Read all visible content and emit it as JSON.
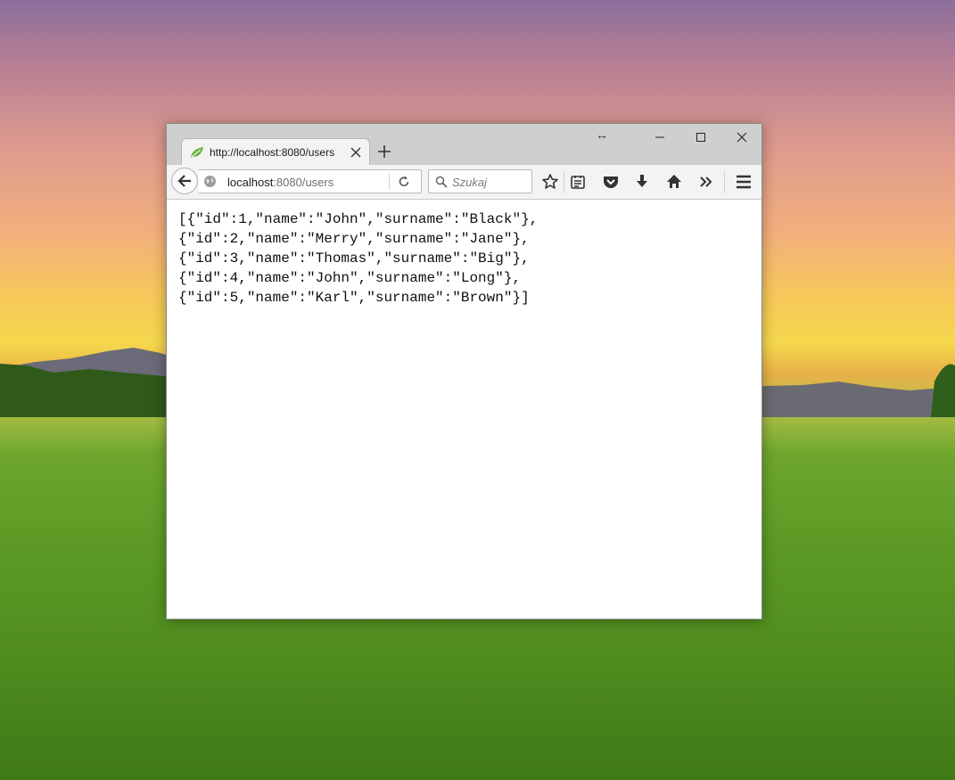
{
  "browser": {
    "tab": {
      "title": "http://localhost:8080/users"
    },
    "urlbar": {
      "host": "localhost",
      "path": ":8080/users"
    },
    "searchbar": {
      "placeholder": "Szukaj"
    }
  },
  "toolbar": {
    "icons": [
      "bookmark-star-icon",
      "reading-list-icon",
      "pocket-icon",
      "download-icon",
      "home-icon",
      "overflow-icon",
      "hamburger-menu-icon"
    ]
  },
  "content": {
    "lines": [
      "[{\"id\":1,\"name\":\"John\",\"surname\":\"Black\"},",
      "{\"id\":2,\"name\":\"Merry\",\"surname\":\"Jane\"},",
      "{\"id\":3,\"name\":\"Thomas\",\"surname\":\"Big\"},",
      "{\"id\":4,\"name\":\"John\",\"surname\":\"Long\"},",
      "{\"id\":5,\"name\":\"Karl\",\"surname\":\"Brown\"}]"
    ]
  },
  "colors": {
    "titlebar": "#cfcfcf",
    "navbar": "#f3f3f3",
    "favicon": "#6db33f"
  }
}
